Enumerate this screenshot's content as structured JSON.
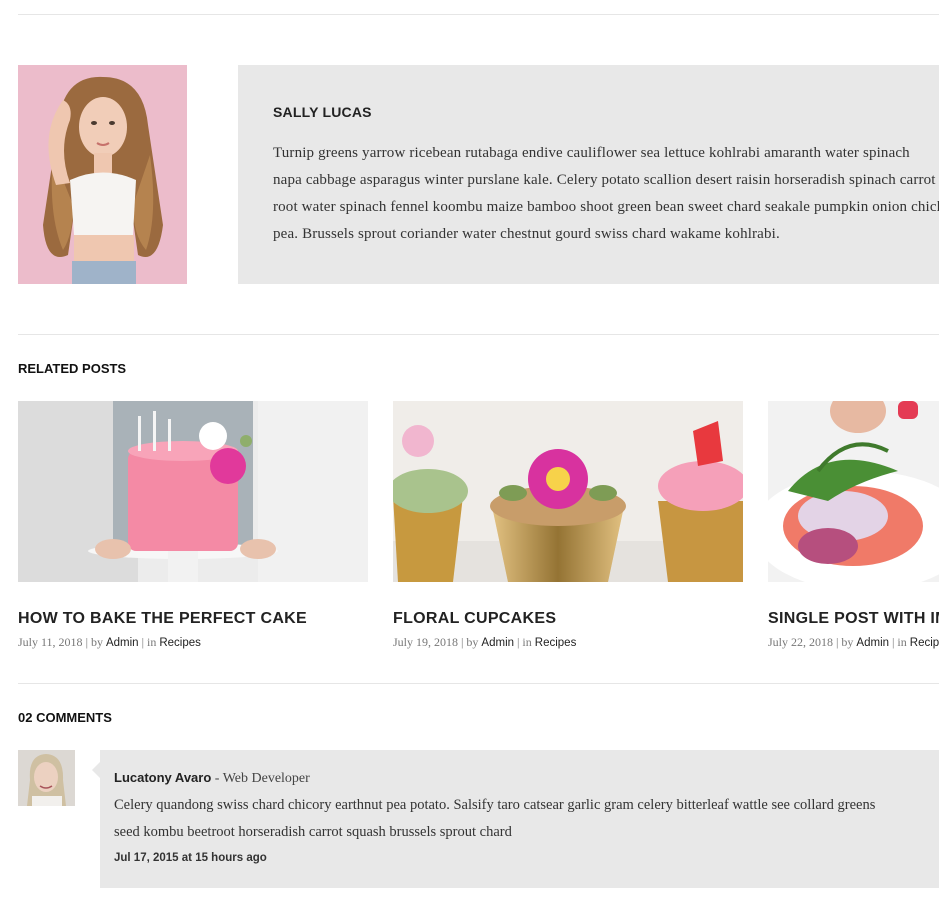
{
  "author": {
    "name": "SALLY LUCAS",
    "bio_lines": [
      "Turnip greens yarrow ricebean rutabaga endive cauliflower sea lettuce kohlrabi amaranth water spinach",
      "napa cabbage asparagus winter purslane kale. Celery potato scallion desert raisin horseradish spinach carrot",
      "root water spinach fennel koombu maize bamboo shoot green bean sweet chard seakale pumpkin onion chickpea",
      "pea. Brussels sprout coriander water chestnut gourd swiss chard wakame kohlrabi."
    ]
  },
  "related": {
    "title": "RELATED POSTS",
    "posts": [
      {
        "title": "HOW TO BAKE THE PERFECT CAKE",
        "date": "July 11, 2018",
        "by": "| by",
        "author": "Admin",
        "in": "| in",
        "category": "Recipes"
      },
      {
        "title": "FLORAL CUPCAKES",
        "date": "July 19, 2018",
        "by": "| by",
        "author": "Admin",
        "in": "| in",
        "category": "Recipes"
      },
      {
        "title": "SINGLE POST WITH IMAGE",
        "date": "July 22, 2018",
        "by": "| by",
        "author": "Admin",
        "in": "| in",
        "category": "Recipes"
      }
    ]
  },
  "comments": {
    "title": "02 COMMENTS",
    "items": [
      {
        "author": "Lucatony Avaro",
        "role": " - Web Developer",
        "text_lines": [
          "Celery quandong swiss chard chicory earthnut pea potato. Salsify taro catsear garlic gram celery bitterleaf wattle see collard greens",
          "seed kombu beetroot horseradish carrot squash brussels sprout chard"
        ],
        "date": "Jul 17, 2015 at 15 hours ago"
      }
    ]
  }
}
